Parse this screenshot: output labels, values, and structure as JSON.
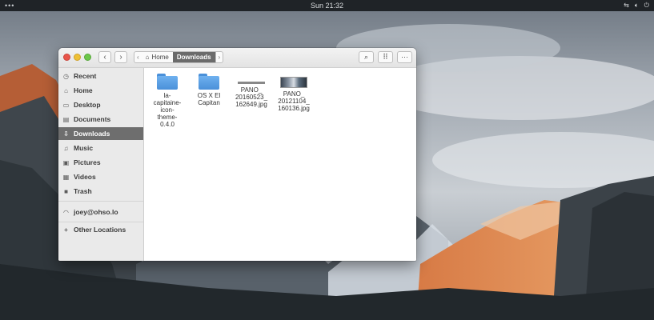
{
  "topbar": {
    "menu_icon": "ellipsis-icon",
    "clock": "Sun 21:32",
    "tray_icons": [
      "network-icon",
      "volume-icon",
      "power-icon"
    ]
  },
  "window": {
    "controls": [
      "close",
      "minimize",
      "maximize"
    ],
    "path": {
      "home": "Home",
      "current": "Downloads"
    },
    "toolbar_icons": [
      "search-icon",
      "grid-view-icon",
      "more-icon"
    ],
    "sidebar": {
      "places": [
        {
          "label": "Recent",
          "icon": "clock-icon"
        },
        {
          "label": "Home",
          "icon": "home-icon"
        },
        {
          "label": "Desktop",
          "icon": "desktop-icon"
        },
        {
          "label": "Documents",
          "icon": "documents-icon"
        },
        {
          "label": "Downloads",
          "icon": "download-icon",
          "active": true
        },
        {
          "label": "Music",
          "icon": "music-icon"
        },
        {
          "label": "Pictures",
          "icon": "pictures-icon"
        },
        {
          "label": "Videos",
          "icon": "videos-icon"
        },
        {
          "label": "Trash",
          "icon": "trash-icon"
        }
      ],
      "network": [
        {
          "label": "joey@ohso.lo",
          "icon": "network-share-icon"
        }
      ],
      "other": [
        {
          "label": "Other Locations",
          "icon": "plus-icon"
        }
      ]
    },
    "files": [
      {
        "name": "la-\ncapitaine-\nicon-\ntheme-\n0.4.0",
        "type": "folder"
      },
      {
        "name": "OS X El\nCapitan",
        "type": "folder"
      },
      {
        "name": "PANO_\n20160523_\n162649.jpg",
        "type": "image"
      },
      {
        "name": "PANO_\n20121104_\n160136.jpg",
        "type": "image"
      }
    ]
  },
  "colors": {
    "topbar": "#1f2327",
    "active_sidebar": "#6e6e6e",
    "folder": "#4a90d9"
  }
}
